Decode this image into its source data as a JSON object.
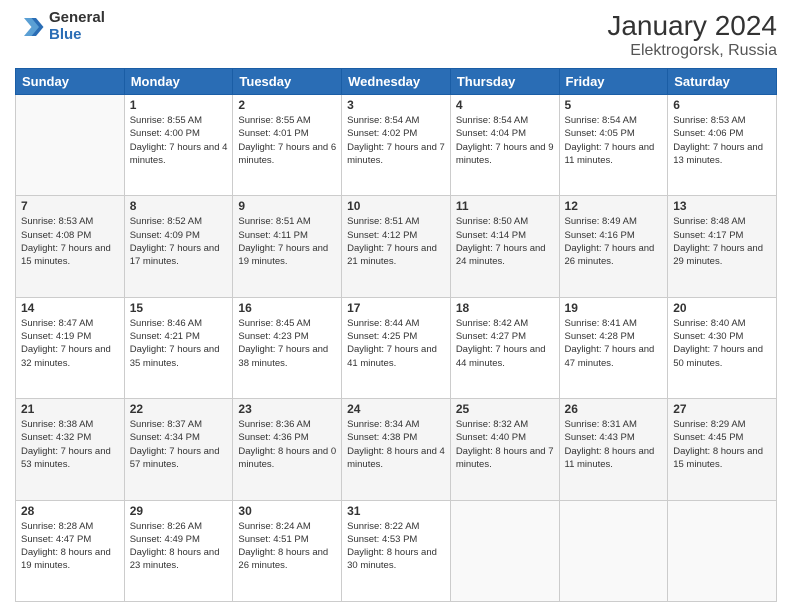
{
  "header": {
    "logo_general": "General",
    "logo_blue": "Blue",
    "month_title": "January 2024",
    "location": "Elektrogorsk, Russia"
  },
  "days_of_week": [
    "Sunday",
    "Monday",
    "Tuesday",
    "Wednesday",
    "Thursday",
    "Friday",
    "Saturday"
  ],
  "weeks": [
    [
      {
        "day": "",
        "sunrise": "",
        "sunset": "",
        "daylight": ""
      },
      {
        "day": "1",
        "sunrise": "Sunrise: 8:55 AM",
        "sunset": "Sunset: 4:00 PM",
        "daylight": "Daylight: 7 hours and 4 minutes."
      },
      {
        "day": "2",
        "sunrise": "Sunrise: 8:55 AM",
        "sunset": "Sunset: 4:01 PM",
        "daylight": "Daylight: 7 hours and 6 minutes."
      },
      {
        "day": "3",
        "sunrise": "Sunrise: 8:54 AM",
        "sunset": "Sunset: 4:02 PM",
        "daylight": "Daylight: 7 hours and 7 minutes."
      },
      {
        "day": "4",
        "sunrise": "Sunrise: 8:54 AM",
        "sunset": "Sunset: 4:04 PM",
        "daylight": "Daylight: 7 hours and 9 minutes."
      },
      {
        "day": "5",
        "sunrise": "Sunrise: 8:54 AM",
        "sunset": "Sunset: 4:05 PM",
        "daylight": "Daylight: 7 hours and 11 minutes."
      },
      {
        "day": "6",
        "sunrise": "Sunrise: 8:53 AM",
        "sunset": "Sunset: 4:06 PM",
        "daylight": "Daylight: 7 hours and 13 minutes."
      }
    ],
    [
      {
        "day": "7",
        "sunrise": "Sunrise: 8:53 AM",
        "sunset": "Sunset: 4:08 PM",
        "daylight": "Daylight: 7 hours and 15 minutes."
      },
      {
        "day": "8",
        "sunrise": "Sunrise: 8:52 AM",
        "sunset": "Sunset: 4:09 PM",
        "daylight": "Daylight: 7 hours and 17 minutes."
      },
      {
        "day": "9",
        "sunrise": "Sunrise: 8:51 AM",
        "sunset": "Sunset: 4:11 PM",
        "daylight": "Daylight: 7 hours and 19 minutes."
      },
      {
        "day": "10",
        "sunrise": "Sunrise: 8:51 AM",
        "sunset": "Sunset: 4:12 PM",
        "daylight": "Daylight: 7 hours and 21 minutes."
      },
      {
        "day": "11",
        "sunrise": "Sunrise: 8:50 AM",
        "sunset": "Sunset: 4:14 PM",
        "daylight": "Daylight: 7 hours and 24 minutes."
      },
      {
        "day": "12",
        "sunrise": "Sunrise: 8:49 AM",
        "sunset": "Sunset: 4:16 PM",
        "daylight": "Daylight: 7 hours and 26 minutes."
      },
      {
        "day": "13",
        "sunrise": "Sunrise: 8:48 AM",
        "sunset": "Sunset: 4:17 PM",
        "daylight": "Daylight: 7 hours and 29 minutes."
      }
    ],
    [
      {
        "day": "14",
        "sunrise": "Sunrise: 8:47 AM",
        "sunset": "Sunset: 4:19 PM",
        "daylight": "Daylight: 7 hours and 32 minutes."
      },
      {
        "day": "15",
        "sunrise": "Sunrise: 8:46 AM",
        "sunset": "Sunset: 4:21 PM",
        "daylight": "Daylight: 7 hours and 35 minutes."
      },
      {
        "day": "16",
        "sunrise": "Sunrise: 8:45 AM",
        "sunset": "Sunset: 4:23 PM",
        "daylight": "Daylight: 7 hours and 38 minutes."
      },
      {
        "day": "17",
        "sunrise": "Sunrise: 8:44 AM",
        "sunset": "Sunset: 4:25 PM",
        "daylight": "Daylight: 7 hours and 41 minutes."
      },
      {
        "day": "18",
        "sunrise": "Sunrise: 8:42 AM",
        "sunset": "Sunset: 4:27 PM",
        "daylight": "Daylight: 7 hours and 44 minutes."
      },
      {
        "day": "19",
        "sunrise": "Sunrise: 8:41 AM",
        "sunset": "Sunset: 4:28 PM",
        "daylight": "Daylight: 7 hours and 47 minutes."
      },
      {
        "day": "20",
        "sunrise": "Sunrise: 8:40 AM",
        "sunset": "Sunset: 4:30 PM",
        "daylight": "Daylight: 7 hours and 50 minutes."
      }
    ],
    [
      {
        "day": "21",
        "sunrise": "Sunrise: 8:38 AM",
        "sunset": "Sunset: 4:32 PM",
        "daylight": "Daylight: 7 hours and 53 minutes."
      },
      {
        "day": "22",
        "sunrise": "Sunrise: 8:37 AM",
        "sunset": "Sunset: 4:34 PM",
        "daylight": "Daylight: 7 hours and 57 minutes."
      },
      {
        "day": "23",
        "sunrise": "Sunrise: 8:36 AM",
        "sunset": "Sunset: 4:36 PM",
        "daylight": "Daylight: 8 hours and 0 minutes."
      },
      {
        "day": "24",
        "sunrise": "Sunrise: 8:34 AM",
        "sunset": "Sunset: 4:38 PM",
        "daylight": "Daylight: 8 hours and 4 minutes."
      },
      {
        "day": "25",
        "sunrise": "Sunrise: 8:32 AM",
        "sunset": "Sunset: 4:40 PM",
        "daylight": "Daylight: 8 hours and 7 minutes."
      },
      {
        "day": "26",
        "sunrise": "Sunrise: 8:31 AM",
        "sunset": "Sunset: 4:43 PM",
        "daylight": "Daylight: 8 hours and 11 minutes."
      },
      {
        "day": "27",
        "sunrise": "Sunrise: 8:29 AM",
        "sunset": "Sunset: 4:45 PM",
        "daylight": "Daylight: 8 hours and 15 minutes."
      }
    ],
    [
      {
        "day": "28",
        "sunrise": "Sunrise: 8:28 AM",
        "sunset": "Sunset: 4:47 PM",
        "daylight": "Daylight: 8 hours and 19 minutes."
      },
      {
        "day": "29",
        "sunrise": "Sunrise: 8:26 AM",
        "sunset": "Sunset: 4:49 PM",
        "daylight": "Daylight: 8 hours and 23 minutes."
      },
      {
        "day": "30",
        "sunrise": "Sunrise: 8:24 AM",
        "sunset": "Sunset: 4:51 PM",
        "daylight": "Daylight: 8 hours and 26 minutes."
      },
      {
        "day": "31",
        "sunrise": "Sunrise: 8:22 AM",
        "sunset": "Sunset: 4:53 PM",
        "daylight": "Daylight: 8 hours and 30 minutes."
      },
      {
        "day": "",
        "sunrise": "",
        "sunset": "",
        "daylight": ""
      },
      {
        "day": "",
        "sunrise": "",
        "sunset": "",
        "daylight": ""
      },
      {
        "day": "",
        "sunrise": "",
        "sunset": "",
        "daylight": ""
      }
    ]
  ]
}
